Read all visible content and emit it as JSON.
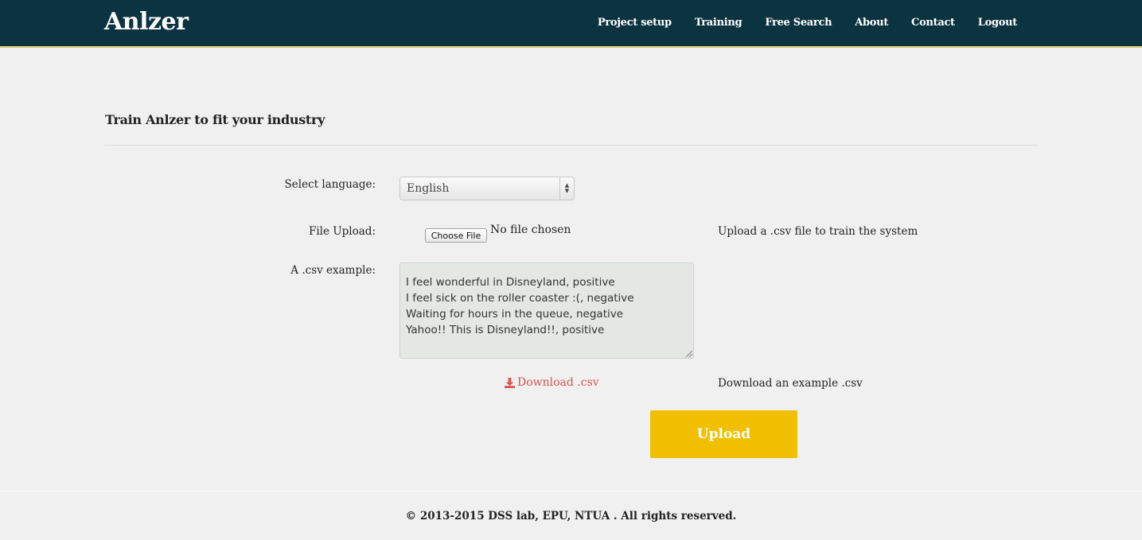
{
  "brand": "Anlzer",
  "nav": {
    "items": [
      "Project setup",
      "Training",
      "Free Search",
      "About",
      "Contact",
      "Logout"
    ]
  },
  "page": {
    "title": "Train Anlzer to fit your industry"
  },
  "form": {
    "language_label": "Select language:",
    "language_value": "English",
    "file_label": "File Upload:",
    "file_button": "Choose File",
    "file_status": "No file chosen",
    "file_hint": "Upload a .csv file to train the system",
    "csv_label": "A .csv example:",
    "csv_lines": [
      "I feel wonderful in Disneyland, positive",
      "I feel sick on the roller coaster :(, negative",
      "Waiting for hours in the queue, negative",
      "Yahoo!! This is Disneyland!!, positive"
    ],
    "download_link": "Download .csv",
    "download_hint": "Download an example .csv",
    "upload_button": "Upload"
  },
  "footer": {
    "text": "© 2013-2015 DSS lab, EPU, NTUA . All rights reserved."
  },
  "colors": {
    "navbar": "#0c3340",
    "accent_button": "#f0c000",
    "download_link": "#d9534f"
  }
}
